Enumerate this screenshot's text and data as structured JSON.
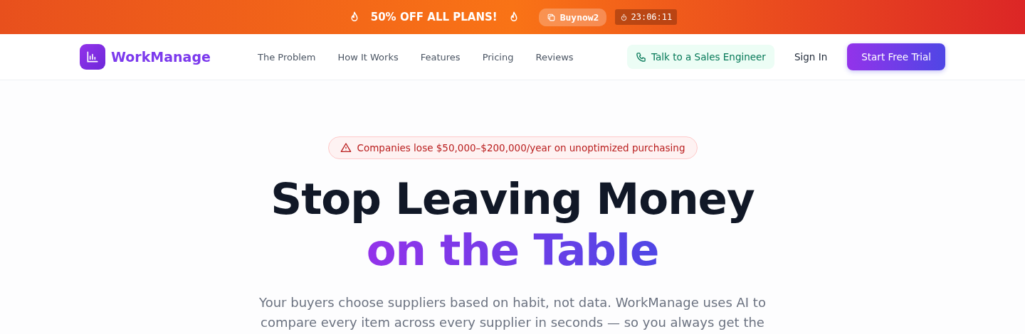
{
  "promo_bar": {
    "headline": "50% OFF ALL PLANS!",
    "coupon_code": "Buynow2",
    "countdown": "23:06:11"
  },
  "nav": {
    "brand": "WorkManage",
    "links": [
      "The Problem",
      "How It Works",
      "Features",
      "Pricing",
      "Reviews"
    ],
    "sales_button": "Talk to a Sales Engineer",
    "sign_in": "Sign In",
    "cta": "Start Free Trial"
  },
  "hero": {
    "alert": "Companies lose $50,000–$200,000/year on unoptimized purchasing",
    "title_line_1": "Stop Leaving Money",
    "title_line_2": "on the Table",
    "subtitle_lines": [
      "Your buyers choose suppliers based on habit, not data. WorkManage uses AI to",
      "compare every item across every supplier in seconds — so you always get the"
    ]
  }
}
